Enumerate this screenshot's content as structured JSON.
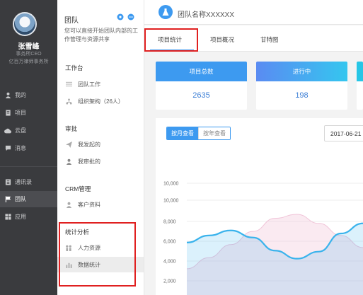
{
  "user": {
    "name": "张雪峰",
    "title": "事务所CEO",
    "company": "亿百万律师事务所"
  },
  "nav": [
    {
      "label": "我的",
      "icon": "person-icon"
    },
    {
      "label": "项目",
      "icon": "document-icon"
    },
    {
      "label": "云盘",
      "icon": "cloud-icon"
    },
    {
      "label": "消息",
      "icon": "chat-icon"
    },
    {
      "label": "通讯录",
      "icon": "contacts-icon"
    },
    {
      "label": "团队",
      "icon": "flag-icon"
    },
    {
      "label": "应用",
      "icon": "grid-icon"
    }
  ],
  "team_panel": {
    "title": "团队",
    "description": "您可以直接开始团队内部的工作管理与资源共享",
    "sections": [
      {
        "heading": "工作台",
        "items": [
          "团队工作",
          "组织架构（26人）"
        ]
      },
      {
        "heading": "审批",
        "items": [
          "我发起的",
          "我审批的"
        ]
      },
      {
        "heading": "CRM管理",
        "items": [
          "客户资料"
        ]
      },
      {
        "heading": "统计分析",
        "items": [
          "人力资源",
          "数据统计"
        ]
      }
    ]
  },
  "header": {
    "team_name": "团队名称XXXXXX"
  },
  "tabs": [
    "项目统计",
    "项目概况",
    "甘特图"
  ],
  "stats": [
    {
      "label": "项目总数",
      "value": "2635",
      "color": "#3d9af0"
    },
    {
      "label": "进行中",
      "value": "198",
      "color": "#5a8bf2"
    }
  ],
  "chart_controls": {
    "by_month": "按月查看",
    "by_year": "按年查看",
    "date": "2017-06-21"
  },
  "chart_data": {
    "type": "area",
    "yticks": [
      "10,000",
      "10,000",
      "8,000",
      "6,000",
      "4,000",
      "2,000"
    ],
    "series": [
      {
        "values": [
          5800,
          6500,
          7000,
          6300,
          5000,
          4200,
          4900,
          6700,
          7700
        ],
        "color": "#3ab3ec"
      },
      {
        "values": [
          3200,
          4300,
          5600,
          6900,
          8200,
          8600,
          7700,
          6500,
          5300
        ],
        "color": "#f0c4d8"
      }
    ]
  }
}
